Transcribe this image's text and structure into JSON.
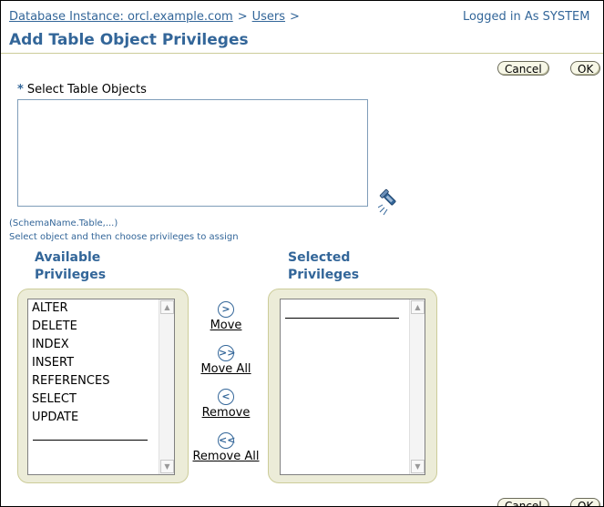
{
  "breadcrumb": {
    "items": [
      "Database Instance: orcl.example.com",
      "Users"
    ],
    "separator": ">"
  },
  "login_status": "Logged in As SYSTEM",
  "page_title": "Add Table Object Privileges",
  "buttons": {
    "cancel": "Cancel",
    "ok": "OK"
  },
  "select_objects": {
    "required_mark": "*",
    "label": "Select Table Objects",
    "value": "",
    "format_hint": "(SchemaName.Table,...)",
    "instruction": "Select object and then choose privileges to assign",
    "search_icon": "flashlight-icon"
  },
  "available": {
    "heading_line1": "Available",
    "heading_line2": "Privileges",
    "items": [
      "ALTER",
      "DELETE",
      "INDEX",
      "INSERT",
      "REFERENCES",
      "SELECT",
      "UPDATE"
    ]
  },
  "selected": {
    "heading_line1": "Selected",
    "heading_line2": "Privileges",
    "items": []
  },
  "shuttle": {
    "move": "Move",
    "move_all": "Move All",
    "remove": "Remove",
    "remove_all": "Remove All",
    "move_icon": ">",
    "move_all_icon": ">>",
    "remove_icon": "<",
    "remove_all_icon": "<<"
  },
  "colors": {
    "link": "#336699",
    "accent_rule": "#CCCC99",
    "shuttle_bg": "#ECECD8",
    "button_bg": "#F7F7E7"
  }
}
